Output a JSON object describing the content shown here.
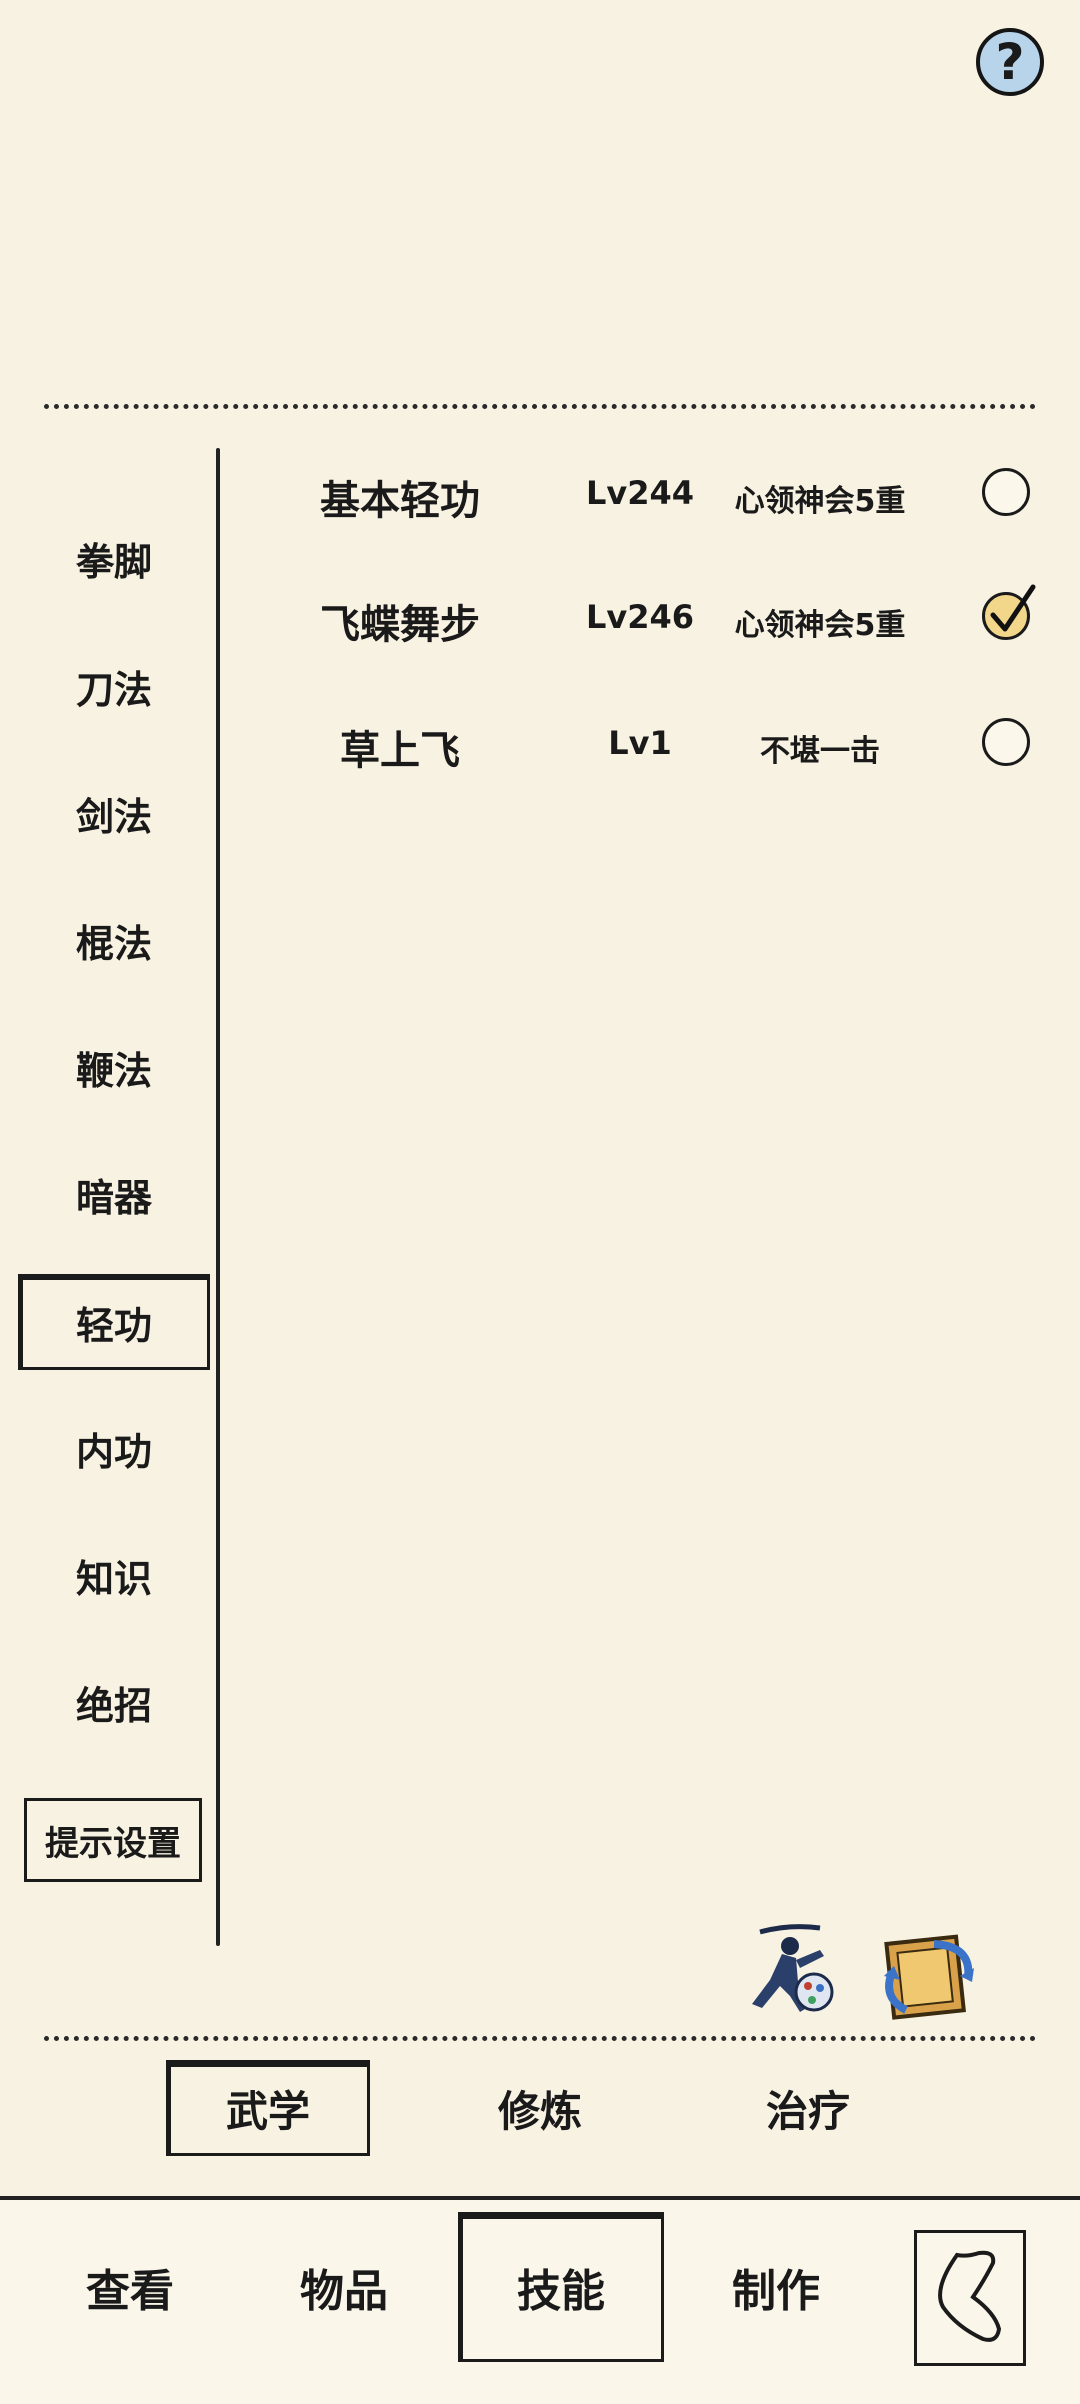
{
  "header": {
    "help_icon": "question-mark-icon"
  },
  "sidebar": {
    "categories": [
      {
        "label": "拳脚"
      },
      {
        "label": "刀法"
      },
      {
        "label": "剑法"
      },
      {
        "label": "棍法"
      },
      {
        "label": "鞭法"
      },
      {
        "label": "暗器"
      },
      {
        "label": "轻功"
      },
      {
        "label": "内功"
      },
      {
        "label": "知识"
      },
      {
        "label": "绝招"
      }
    ],
    "selected": "轻功",
    "tip_settings_label": "提示设置"
  },
  "skills": [
    {
      "name": "基本轻功",
      "level": "Lv244",
      "rank": "心领神会5重",
      "checked": false
    },
    {
      "name": "飞蝶舞步",
      "level": "Lv246",
      "rank": "心领神会5重",
      "checked": true
    },
    {
      "name": "草上飞",
      "level": "Lv1",
      "rank": "不堪一击",
      "checked": false
    }
  ],
  "icons": {
    "fighter": "martial-artist-icon",
    "scroll": "swap-scroll-icon"
  },
  "subtabs": [
    {
      "label": "武学"
    },
    {
      "label": "修炼"
    },
    {
      "label": "治疗"
    }
  ],
  "subtab_selected": "武学",
  "nav": [
    {
      "label": "查看"
    },
    {
      "label": "物品"
    },
    {
      "label": "技能"
    },
    {
      "label": "制作"
    }
  ],
  "nav_selected": "技能",
  "colors": {
    "background": "#f8f2e2",
    "help_icon": "#b8d4ea",
    "checked_radio": "#f2d68a",
    "ink": "#1a1a1a"
  }
}
